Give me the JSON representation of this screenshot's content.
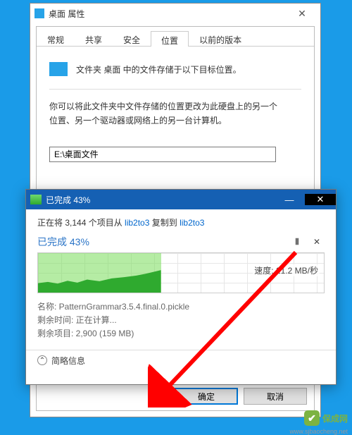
{
  "props": {
    "title": "桌面 属性",
    "tabs": [
      "常规",
      "共享",
      "安全",
      "位置",
      "以前的版本"
    ],
    "active_tab": "位置",
    "location_line": "文件夹 桌面 中的文件存储于以下目标位置。",
    "explain1": "你可以将此文件夹中文件存储的位置更改为此硬盘上的另一个",
    "explain2": "位置、另一个驱动器或网络上的另一台计算机。",
    "path_value": "E:\\桌面文件",
    "ok": "确定",
    "cancel": "取消"
  },
  "copy": {
    "title": "已完成 43%",
    "line_prefix": "正在将 3,144 个项目从 ",
    "src": "lib2to3",
    "line_mid": " 复制到 ",
    "dst": "lib2to3",
    "heading": "已完成 43%",
    "percent": 43,
    "speed_label": "速度: ",
    "speed_value": "21.2 MB/秒",
    "name_label": "名称: ",
    "name_value": "PatternGrammar3.5.4.final.0.pickle",
    "remain_time_label": "剩余时间: ",
    "remain_time_value": "正在计算...",
    "remain_items_label": "剩余项目: ",
    "remain_items_value": "2,900 (159 MB)",
    "fewer": "简略信息"
  },
  "watermark": {
    "brand": "保成网",
    "url": "www.sjbaocheng.net"
  }
}
